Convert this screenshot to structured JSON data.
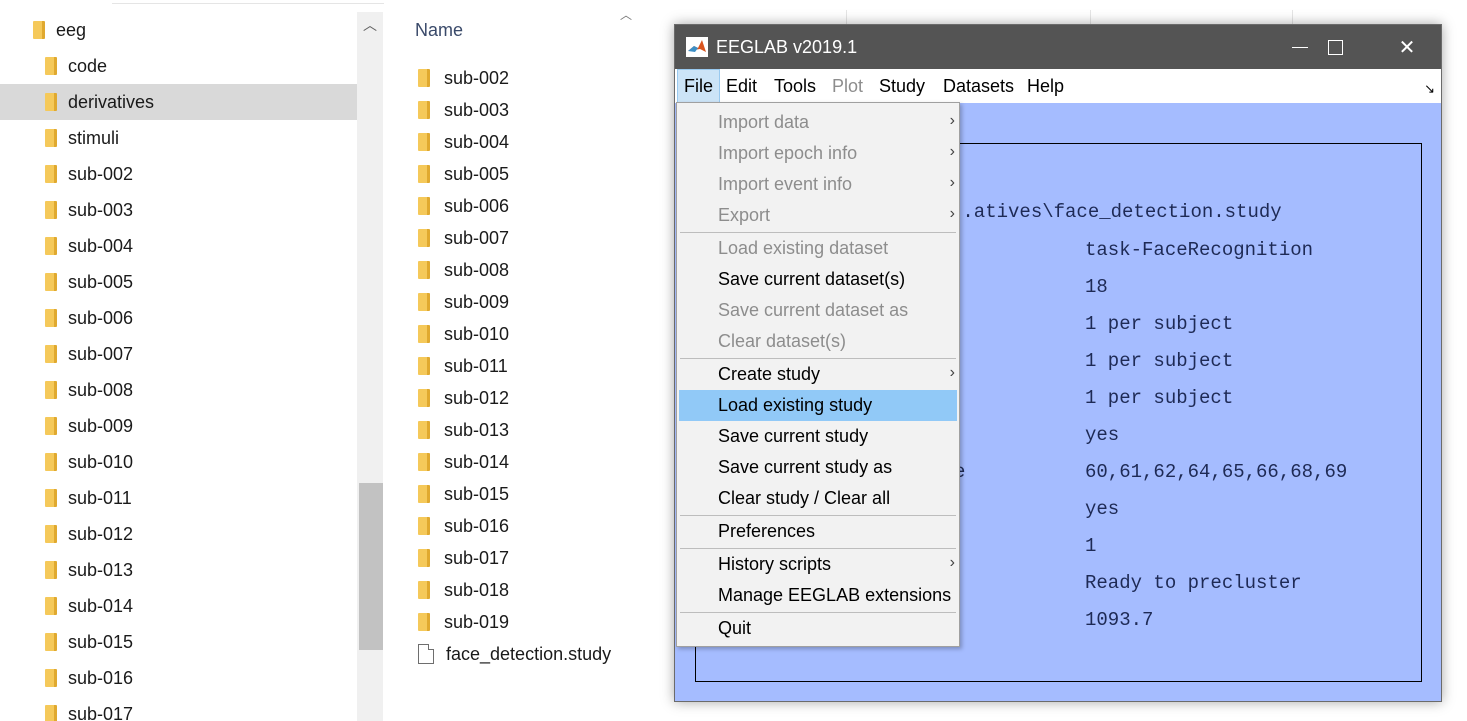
{
  "explorer": {
    "tree": [
      {
        "label": "eeg",
        "selected": false
      },
      {
        "label": "code",
        "selected": false
      },
      {
        "label": "derivatives",
        "selected": true
      },
      {
        "label": "stimuli",
        "selected": false
      },
      {
        "label": "sub-002",
        "selected": false
      },
      {
        "label": "sub-003",
        "selected": false
      },
      {
        "label": "sub-004",
        "selected": false
      },
      {
        "label": "sub-005",
        "selected": false
      },
      {
        "label": "sub-006",
        "selected": false
      },
      {
        "label": "sub-007",
        "selected": false
      },
      {
        "label": "sub-008",
        "selected": false
      },
      {
        "label": "sub-009",
        "selected": false
      },
      {
        "label": "sub-010",
        "selected": false
      },
      {
        "label": "sub-011",
        "selected": false
      },
      {
        "label": "sub-012",
        "selected": false
      },
      {
        "label": "sub-013",
        "selected": false
      },
      {
        "label": "sub-014",
        "selected": false
      },
      {
        "label": "sub-015",
        "selected": false
      },
      {
        "label": "sub-016",
        "selected": false
      },
      {
        "label": "sub-017",
        "selected": false
      }
    ],
    "list_header": "Name",
    "files": [
      {
        "name": "sub-002",
        "type": "folder"
      },
      {
        "name": "sub-003",
        "type": "folder"
      },
      {
        "name": "sub-004",
        "type": "folder"
      },
      {
        "name": "sub-005",
        "type": "folder"
      },
      {
        "name": "sub-006",
        "type": "folder"
      },
      {
        "name": "sub-007",
        "type": "folder"
      },
      {
        "name": "sub-008",
        "type": "folder"
      },
      {
        "name": "sub-009",
        "type": "folder"
      },
      {
        "name": "sub-010",
        "type": "folder"
      },
      {
        "name": "sub-011",
        "type": "folder"
      },
      {
        "name": "sub-012",
        "type": "folder"
      },
      {
        "name": "sub-013",
        "type": "folder"
      },
      {
        "name": "sub-014",
        "type": "folder"
      },
      {
        "name": "sub-015",
        "type": "folder"
      },
      {
        "name": "sub-016",
        "type": "folder"
      },
      {
        "name": "sub-017",
        "type": "folder"
      },
      {
        "name": "sub-018",
        "type": "folder"
      },
      {
        "name": "sub-019",
        "type": "folder"
      },
      {
        "name": "face_detection.study",
        "type": "file"
      }
    ]
  },
  "eeglab": {
    "title": "EEGLAB v2019.1",
    "menus": [
      {
        "label": "File",
        "state": "active"
      },
      {
        "label": "Edit",
        "state": "normal"
      },
      {
        "label": "Tools",
        "state": "normal"
      },
      {
        "label": "Plot",
        "state": "disabled"
      },
      {
        "label": "Study",
        "state": "normal"
      },
      {
        "label": "Datasets",
        "state": "normal"
      },
      {
        "label": "Help",
        "state": "normal"
      }
    ],
    "corner_glyph": "↘",
    "info": {
      "filename": "..atives\\face_detection.study",
      "rows": [
        {
          "label": "",
          "value": "task-FaceRecognition"
        },
        {
          "label": "",
          "value": "18"
        },
        {
          "label": "",
          "value": "1 per subject"
        },
        {
          "label": "",
          "value": "1 per subject"
        },
        {
          "label": "",
          "value": "1 per subject"
        },
        {
          "label": "",
          "value": "yes"
        },
        {
          "label": "e",
          "value": "60,61,62,64,65,66,68,69"
        },
        {
          "label": "",
          "value": "yes"
        },
        {
          "label": "",
          "value": "1"
        },
        {
          "label": "",
          "value": "Ready to precluster"
        },
        {
          "label": "",
          "value": "1093.7"
        }
      ]
    },
    "file_menu": [
      {
        "label": "Import data",
        "disabled": true,
        "submenu": true
      },
      {
        "label": "Import epoch info",
        "disabled": true,
        "submenu": true
      },
      {
        "label": "Import event info",
        "disabled": true,
        "submenu": true
      },
      {
        "label": "Export",
        "disabled": true,
        "submenu": true
      },
      {
        "separator": true
      },
      {
        "label": "Load existing dataset",
        "disabled": true
      },
      {
        "label": "Save current dataset(s)",
        "disabled": false
      },
      {
        "label": "Save current dataset as",
        "disabled": true
      },
      {
        "label": "Clear dataset(s)",
        "disabled": true
      },
      {
        "separator": true
      },
      {
        "label": "Create study",
        "disabled": false,
        "submenu": true
      },
      {
        "label": "Load existing study",
        "disabled": false,
        "highlight": true
      },
      {
        "label": "Save current study",
        "disabled": false
      },
      {
        "label": "Save current study as",
        "disabled": false
      },
      {
        "label": "Clear study / Clear all",
        "disabled": false
      },
      {
        "separator": true
      },
      {
        "label": "Preferences",
        "disabled": false
      },
      {
        "separator": true
      },
      {
        "label": "History scripts",
        "disabled": false,
        "submenu": true
      },
      {
        "label": "Manage EEGLAB extensions",
        "disabled": false
      },
      {
        "separator": true
      },
      {
        "label": "Quit",
        "disabled": false
      }
    ]
  },
  "colors": {
    "client_bg": "#a5bcff",
    "highlight": "#91c9f7",
    "titlebar": "#545454"
  }
}
